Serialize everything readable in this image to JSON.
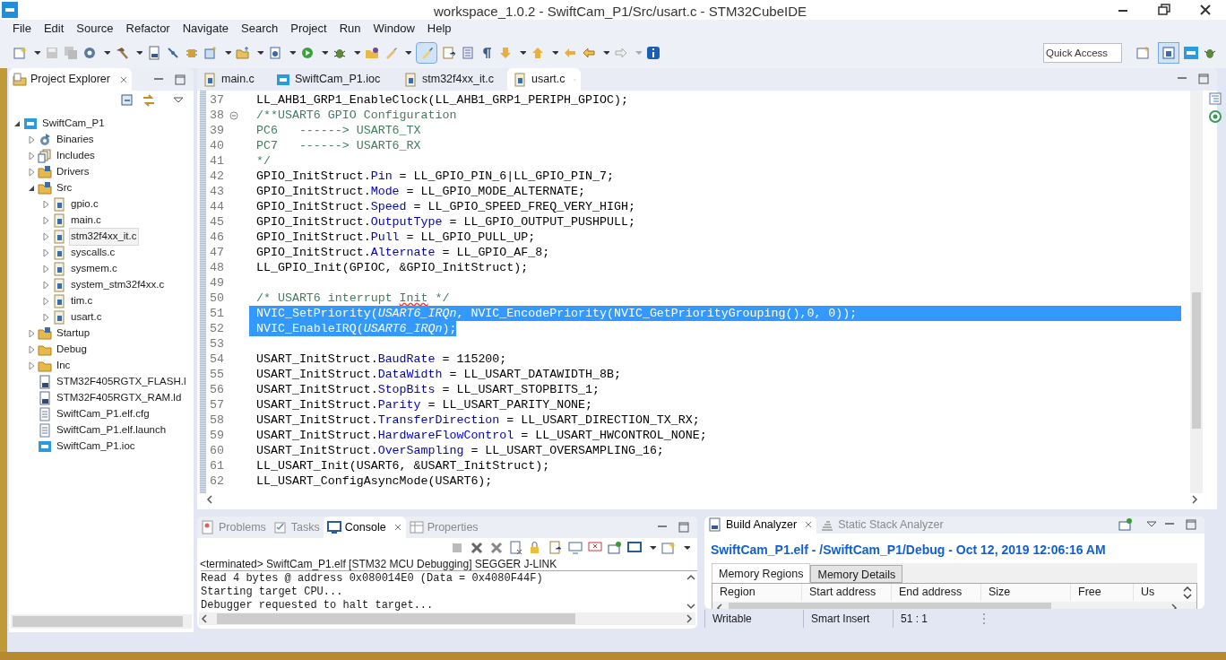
{
  "window": {
    "title": "workspace_1.0.2 - SwiftCam_P1/Src/usart.c - STM32CubeIDE"
  },
  "menu": [
    "File",
    "Edit",
    "Source",
    "Refactor",
    "Navigate",
    "Search",
    "Project",
    "Run",
    "Window",
    "Help"
  ],
  "toolbar": {
    "highlight_toggle": {
      "on": true
    },
    "quick_access": {
      "placeholder": "Quick Access"
    }
  },
  "project_explorer": {
    "title": "Project Explorer",
    "tree": [
      {
        "label": "SwiftCam_P1",
        "kind": "project",
        "expanded": true,
        "selected": false,
        "children": [
          {
            "label": "Binaries",
            "kind": "binaries",
            "expanded": false,
            "selected": false
          },
          {
            "label": "Includes",
            "kind": "includes",
            "expanded": false,
            "selected": false
          },
          {
            "label": "Drivers",
            "kind": "source-folder",
            "expanded": false,
            "selected": false
          },
          {
            "label": "Src",
            "kind": "source-folder",
            "expanded": true,
            "selected": false,
            "children": [
              {
                "label": "gpio.c",
                "kind": "c-file",
                "expanded": false,
                "selected": false
              },
              {
                "label": "main.c",
                "kind": "c-file",
                "expanded": false,
                "selected": false
              },
              {
                "label": "stm32f4xx_it.c",
                "kind": "c-file",
                "expanded": false,
                "selected": true
              },
              {
                "label": "syscalls.c",
                "kind": "c-file",
                "expanded": false,
                "selected": false
              },
              {
                "label": "sysmem.c",
                "kind": "c-file",
                "expanded": false,
                "selected": false
              },
              {
                "label": "system_stm32f4xx.c",
                "kind": "c-file",
                "expanded": false,
                "selected": false
              },
              {
                "label": "tim.c",
                "kind": "c-file",
                "expanded": false,
                "selected": false
              },
              {
                "label": "usart.c",
                "kind": "c-file",
                "expanded": false,
                "selected": false
              }
            ]
          },
          {
            "label": "Startup",
            "kind": "source-folder",
            "expanded": false,
            "selected": false
          },
          {
            "label": "Debug",
            "kind": "folder",
            "expanded": false,
            "selected": false
          },
          {
            "label": "Inc",
            "kind": "folder",
            "expanded": false,
            "selected": false
          },
          {
            "label": "STM32F405RGTX_FLASH.l",
            "kind": "ld-file",
            "selected": false
          },
          {
            "label": "STM32F405RGTX_RAM.ld",
            "kind": "ld-file",
            "selected": false
          },
          {
            "label": "SwiftCam_P1.elf.cfg",
            "kind": "text-file",
            "selected": false
          },
          {
            "label": "SwiftCam_P1.elf.launch",
            "kind": "text-file",
            "selected": false
          },
          {
            "label": "SwiftCam_P1.ioc",
            "kind": "mx-file",
            "selected": false
          }
        ]
      }
    ]
  },
  "editor": {
    "tabs": [
      {
        "label": "main.c",
        "kind": "c-file",
        "selected": false
      },
      {
        "label": "SwiftCam_P1.ioc",
        "kind": "mx-file",
        "selected": false
      },
      {
        "label": "stm32f4xx_it.c",
        "kind": "c-file",
        "selected": false
      },
      {
        "label": "usart.c",
        "kind": "c-file",
        "selected": true
      }
    ],
    "lines": [
      {
        "number": "37",
        "selected": false,
        "tokens": [
          {
            "kind": "code",
            "text": "LL_AHB1_GRP1_EnableClock(LL_AHB1_GRP1_PERIPH_GPIOC);"
          }
        ]
      },
      {
        "number": "38",
        "selected": false,
        "folded": false,
        "tokens": [
          {
            "kind": "comment",
            "text": "/**USART6 GPIO Configuration"
          }
        ]
      },
      {
        "number": "39",
        "selected": false,
        "tokens": [
          {
            "kind": "comment",
            "text": "PC6   ------> USART6_TX"
          }
        ]
      },
      {
        "number": "40",
        "selected": false,
        "tokens": [
          {
            "kind": "comment",
            "text": "PC7   ------> USART6_RX"
          }
        ]
      },
      {
        "number": "41",
        "selected": false,
        "tokens": [
          {
            "kind": "comment",
            "text": "*/"
          }
        ]
      },
      {
        "number": "42",
        "selected": false,
        "tokens": [
          {
            "kind": "code",
            "text": "GPIO_InitStruct."
          },
          {
            "kind": "field",
            "text": "Pin"
          },
          {
            "kind": "code",
            "text": " = LL_GPIO_PIN_6|LL_GPIO_PIN_7;"
          }
        ]
      },
      {
        "number": "43",
        "selected": false,
        "tokens": [
          {
            "kind": "code",
            "text": "GPIO_InitStruct."
          },
          {
            "kind": "field",
            "text": "Mode"
          },
          {
            "kind": "code",
            "text": " = LL_GPIO_MODE_ALTERNATE;"
          }
        ]
      },
      {
        "number": "44",
        "selected": false,
        "tokens": [
          {
            "kind": "code",
            "text": "GPIO_InitStruct."
          },
          {
            "kind": "field",
            "text": "Speed"
          },
          {
            "kind": "code",
            "text": " = LL_GPIO_SPEED_FREQ_VERY_HIGH;"
          }
        ]
      },
      {
        "number": "45",
        "selected": false,
        "tokens": [
          {
            "kind": "code",
            "text": "GPIO_InitStruct."
          },
          {
            "kind": "field",
            "text": "OutputType"
          },
          {
            "kind": "code",
            "text": " = LL_GPIO_OUTPUT_PUSHPULL;"
          }
        ]
      },
      {
        "number": "46",
        "selected": false,
        "tokens": [
          {
            "kind": "code",
            "text": "GPIO_InitStruct."
          },
          {
            "kind": "field",
            "text": "Pull"
          },
          {
            "kind": "code",
            "text": " = LL_GPIO_PULL_UP;"
          }
        ]
      },
      {
        "number": "47",
        "selected": false,
        "tokens": [
          {
            "kind": "code",
            "text": "GPIO_InitStruct."
          },
          {
            "kind": "field",
            "text": "Alternate"
          },
          {
            "kind": "code",
            "text": " = LL_GPIO_AF_8;"
          }
        ]
      },
      {
        "number": "48",
        "selected": false,
        "tokens": [
          {
            "kind": "code",
            "text": "LL_GPIO_Init(GPIOC, &GPIO_InitStruct);"
          }
        ]
      },
      {
        "number": "49",
        "selected": false
      },
      {
        "number": "50",
        "selected": false,
        "tokens": [
          {
            "kind": "comment",
            "text": "/* USART6 interrupt "
          },
          {
            "kind": "misspelled",
            "text": "Init"
          },
          {
            "kind": "comment",
            "text": " */"
          }
        ]
      },
      {
        "number": "51",
        "selected": true,
        "tokens": [
          {
            "kind": "code",
            "text": "NVIC_SetPriority("
          },
          {
            "kind": "param",
            "text": "USART6_IRQn"
          },
          {
            "kind": "code",
            "text": ", NVIC_EncodePriority(NVIC_GetPriorityGrouping(),0, 0));"
          }
        ]
      },
      {
        "number": "52",
        "selected": true,
        "tokens": [
          {
            "kind": "code",
            "text": "NVIC_EnableIRQ("
          },
          {
            "kind": "param",
            "text": "USART6_IRQn"
          },
          {
            "kind": "code",
            "text": ");"
          }
        ]
      },
      {
        "number": "53",
        "selected": false
      },
      {
        "number": "54",
        "selected": false,
        "tokens": [
          {
            "kind": "code",
            "text": "USART_InitStruct."
          },
          {
            "kind": "field",
            "text": "BaudRate"
          },
          {
            "kind": "code",
            "text": " = 115200;"
          }
        ]
      },
      {
        "number": "55",
        "selected": false,
        "tokens": [
          {
            "kind": "code",
            "text": "USART_InitStruct."
          },
          {
            "kind": "field",
            "text": "DataWidth"
          },
          {
            "kind": "code",
            "text": " = LL_USART_DATAWIDTH_8B;"
          }
        ]
      },
      {
        "number": "56",
        "selected": false,
        "tokens": [
          {
            "kind": "code",
            "text": "USART_InitStruct."
          },
          {
            "kind": "field",
            "text": "StopBits"
          },
          {
            "kind": "code",
            "text": " = LL_USART_STOPBITS_1;"
          }
        ]
      },
      {
        "number": "57",
        "selected": false,
        "tokens": [
          {
            "kind": "code",
            "text": "USART_InitStruct."
          },
          {
            "kind": "field",
            "text": "Parity"
          },
          {
            "kind": "code",
            "text": " = LL_USART_PARITY_NONE;"
          }
        ]
      },
      {
        "number": "58",
        "selected": false,
        "tokens": [
          {
            "kind": "code",
            "text": "USART_InitStruct."
          },
          {
            "kind": "field",
            "text": "TransferDirection"
          },
          {
            "kind": "code",
            "text": " = LL_USART_DIRECTION_TX_RX;"
          }
        ]
      },
      {
        "number": "59",
        "selected": false,
        "tokens": [
          {
            "kind": "code",
            "text": "USART_InitStruct."
          },
          {
            "kind": "field",
            "text": "HardwareFlowControl"
          },
          {
            "kind": "code",
            "text": " = LL_USART_HWCONTROL_NONE;"
          }
        ]
      },
      {
        "number": "60",
        "selected": false,
        "tokens": [
          {
            "kind": "code",
            "text": "USART_InitStruct."
          },
          {
            "kind": "field",
            "text": "OverSampling"
          },
          {
            "kind": "code",
            "text": " = LL_USART_OVERSAMPLING_16;"
          }
        ]
      },
      {
        "number": "61",
        "selected": false,
        "tokens": [
          {
            "kind": "code",
            "text": "LL_USART_Init(USART6, &USART_InitStruct);"
          }
        ]
      },
      {
        "number": "62",
        "selected": false,
        "tokens": [
          {
            "kind": "code",
            "text": "LL_USART_ConfigAsyncMode(USART6);"
          }
        ]
      }
    ]
  },
  "console_panel": {
    "tabs": [
      {
        "label": "Problems",
        "kind": "problems",
        "selected": false
      },
      {
        "label": "Tasks",
        "kind": "tasks",
        "selected": false
      },
      {
        "label": "Console",
        "kind": "console",
        "selected": true
      },
      {
        "label": "Properties",
        "kind": "properties",
        "selected": false
      }
    ],
    "header": "<terminated> SwiftCam_P1.elf [STM32 MCU Debugging] SEGGER J-LINK",
    "output": [
      "Read 4 bytes @ address 0x080014E0 (Data = 0x4080F44F)",
      "Starting target CPU...",
      "Debugger requested to halt target..."
    ]
  },
  "build_analyzer": {
    "tabs": [
      {
        "label": "Build Analyzer",
        "kind": "build",
        "selected": true
      },
      {
        "label": "Static Stack Analyzer",
        "kind": "stack",
        "selected": false
      }
    ],
    "heading": "SwiftCam_P1.elf - /SwiftCam_P1/Debug - Oct 12, 2019 12:06:16 AM",
    "subtabs": [
      {
        "label": "Memory Regions",
        "selected": true
      },
      {
        "label": "Memory Details",
        "selected": false
      }
    ],
    "columns": [
      "Region",
      "Start address",
      "End address",
      "Size",
      "Free",
      "Us"
    ]
  },
  "status_bar": [
    "Writable",
    "Smart Insert",
    "51 : 1"
  ]
}
